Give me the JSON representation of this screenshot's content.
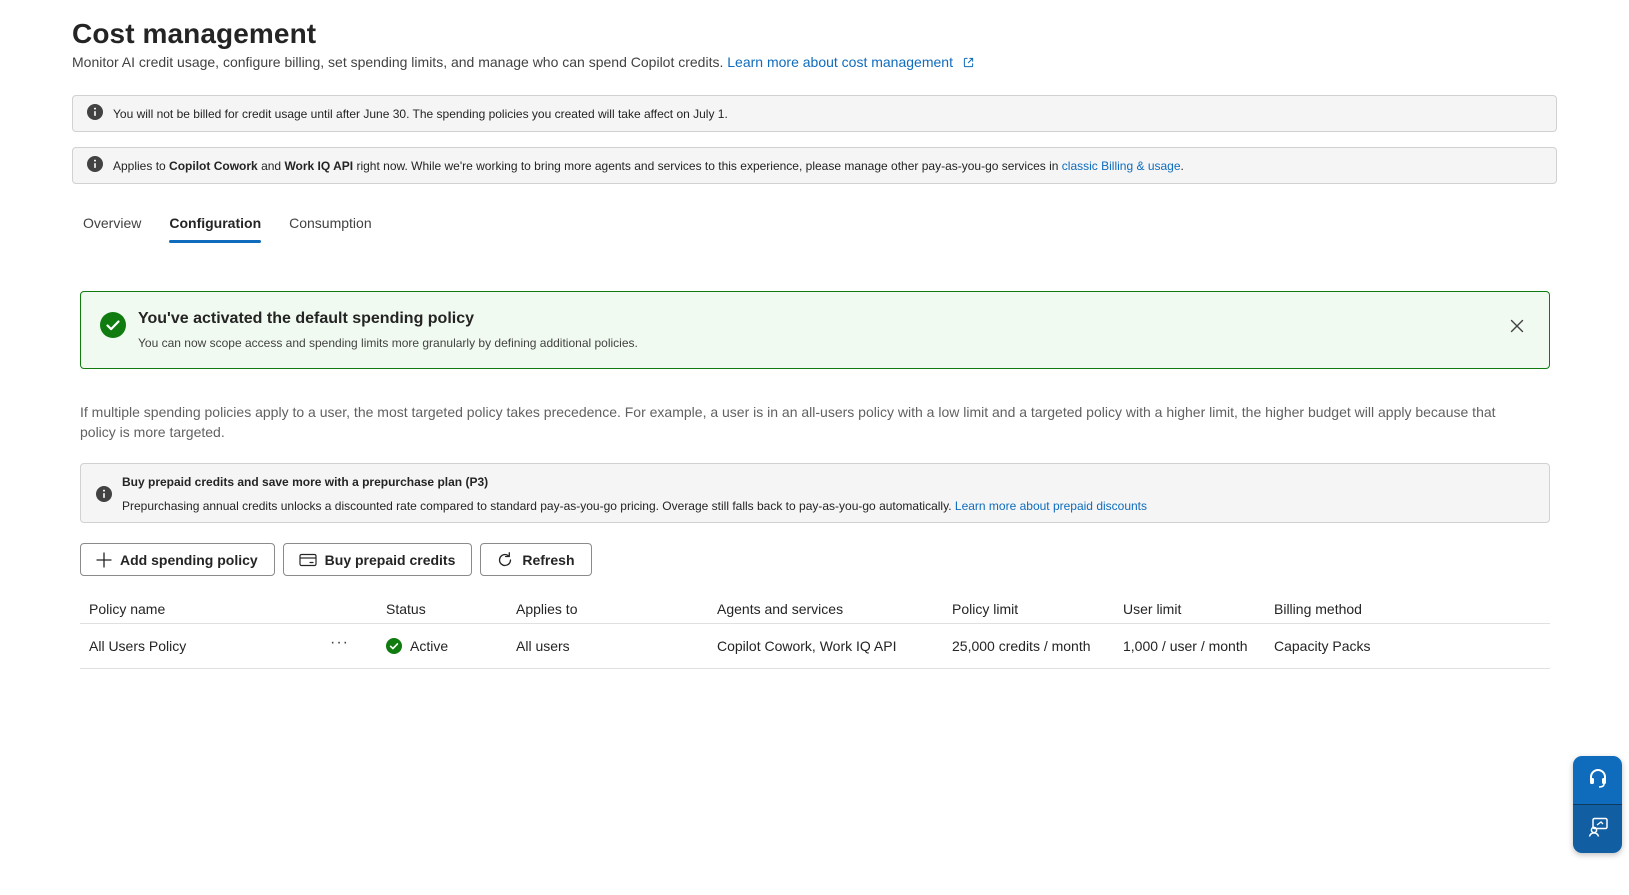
{
  "header": {
    "title": "Cost management",
    "subtitle": "Monitor AI credit usage, configure billing, set spending limits, and manage who can spend Copilot credits.",
    "learn_more": "Learn more about cost management"
  },
  "notice_billing": {
    "text": "You will not be billed for credit usage until after June 30. The spending policies you created will take affect on July 1."
  },
  "notice_scope": {
    "prefix": "Applies to",
    "product1": "Copilot Cowork",
    "and": "and",
    "product2": "Work IQ API",
    "middle": "right now. While we're working to bring more agents and services to this experience, please manage other pay-as-you-go services in",
    "link": "classic Billing & usage",
    "suffix": "."
  },
  "tabs": [
    {
      "label": "Overview",
      "active": false
    },
    {
      "label": "Configuration",
      "active": true
    },
    {
      "label": "Consumption",
      "active": false
    }
  ],
  "success_banner": {
    "title": "You've activated the default spending policy",
    "body": "You can now scope access and spending limits more granularly by defining additional policies."
  },
  "explanation": "If multiple spending policies apply to a user, the most targeted policy takes precedence. For example, a user is in an all-users policy with a low limit and a targeted policy with a higher limit, the higher budget will apply because that policy is more targeted.",
  "prepaid_banner": {
    "title": "Buy prepaid credits and save more with a prepurchase plan (P3)",
    "body": "Prepurchasing annual credits unlocks a discounted rate compared to standard pay-as-you-go pricing. Overage still falls back to pay-as-you-go automatically.",
    "link": "Learn more about prepaid discounts"
  },
  "toolbar": {
    "add_label": "Add spending policy",
    "buy_label": "Buy prepaid credits",
    "refresh_label": "Refresh"
  },
  "table": {
    "columns": [
      "Policy name",
      "Status",
      "Applies to",
      "Agents and services",
      "Policy limit",
      "User limit",
      "Billing method"
    ],
    "rows": [
      {
        "policy_name": "All Users Policy",
        "more": "···",
        "status": "Active",
        "applies_to": "All users",
        "agents": "Copilot Cowork, Work IQ API",
        "policy_limit": "25,000 credits / month",
        "user_limit": "1,000 / user / month",
        "billing_method": "Capacity Packs"
      }
    ]
  },
  "colors": {
    "accent": "#0f6cbd",
    "success": "#107c10",
    "success_bg": "#f1faf1",
    "info_bg": "#f5f5f5"
  },
  "icons": {
    "info": "info-icon",
    "external": "open-external-icon",
    "success": "checkmark-circle-icon",
    "close": "dismiss-icon",
    "add": "add-icon",
    "card": "credit-card-icon",
    "refresh": "refresh-icon",
    "help": "headset-icon",
    "feedback": "feedback-icon"
  }
}
